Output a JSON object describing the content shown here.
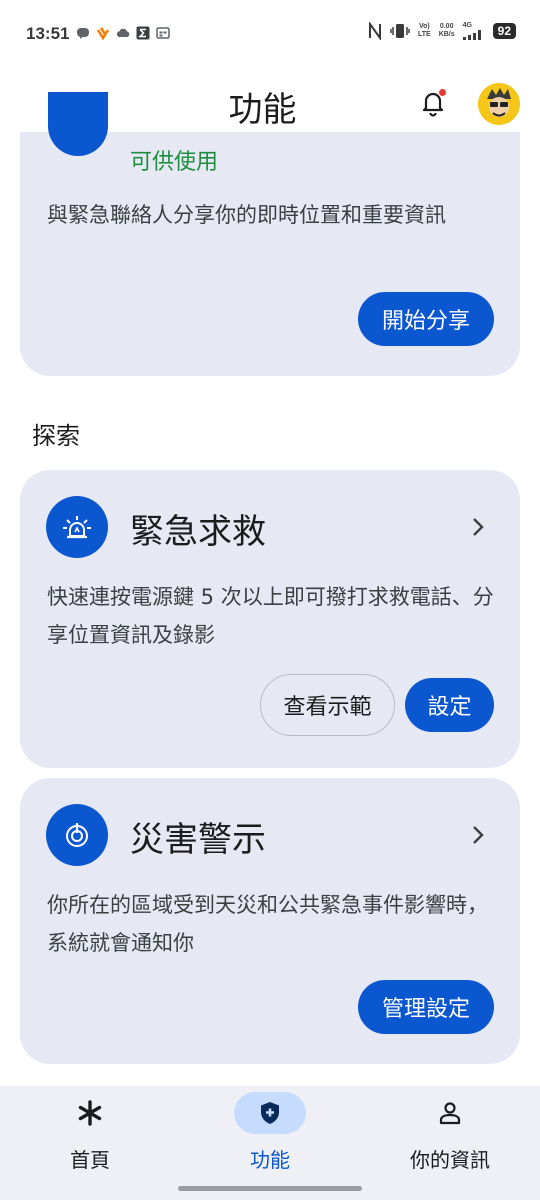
{
  "status": {
    "time": "13:51",
    "net_speed_top": "0.00",
    "net_speed_bottom": "KB/s",
    "volte_top": "Vo)",
    "volte_bottom": "LTE",
    "network_type": "4G",
    "battery": "92"
  },
  "header": {
    "title": "功能"
  },
  "top_card": {
    "status": "可供使用",
    "description": "與緊急聯絡人分享你的即時位置和重要資訊",
    "button": "開始分享"
  },
  "explore": {
    "heading": "探索",
    "emergency": {
      "title": "緊急求救",
      "description": "快速連按電源鍵 5 次以上即可撥打求救電話、分享位置資訊及錄影",
      "demo_button": "查看示範",
      "setup_button": "設定"
    },
    "disaster": {
      "title": "災害警示",
      "description": "你所在的區域受到天災和公共緊急事件影響時，系統就會通知你",
      "button": "管理設定"
    }
  },
  "nav": {
    "home": "首頁",
    "features": "功能",
    "info": "你的資訊",
    "active": "features"
  },
  "colors": {
    "accent": "#0b57d0",
    "card_bg": "#e6e9f3",
    "available_green": "#1e8e3e",
    "nav_active_pill": "#c6dcff"
  }
}
